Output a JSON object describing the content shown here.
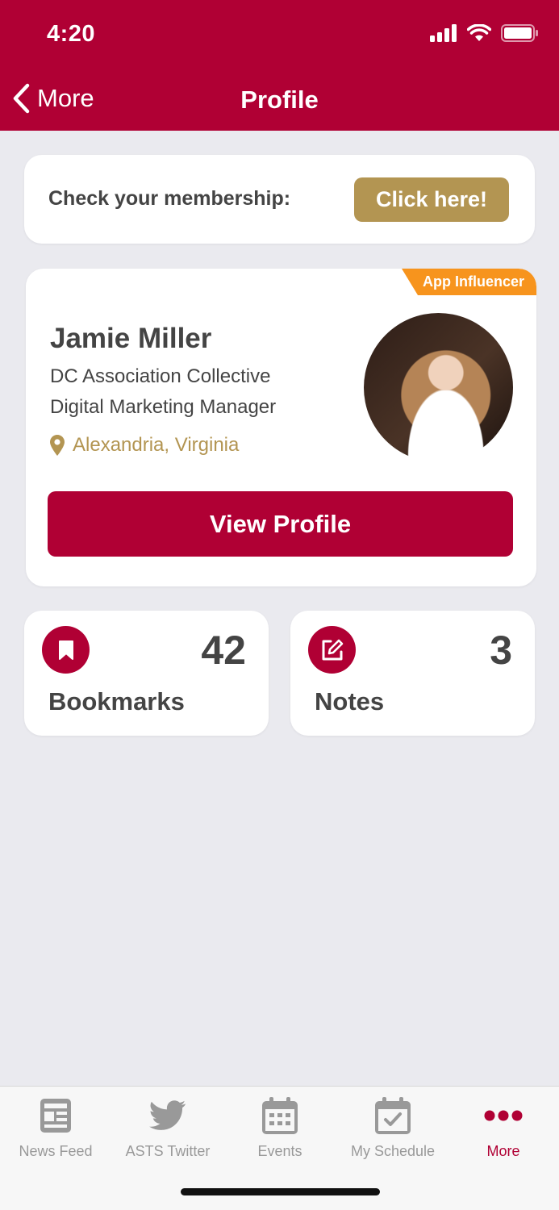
{
  "status": {
    "time": "4:20"
  },
  "nav": {
    "back_label": "More",
    "title": "Profile"
  },
  "membership": {
    "label": "Check your membership:",
    "button": "Click here!"
  },
  "profile": {
    "badge": "App Influencer",
    "name": "Jamie Miller",
    "organization": "DC Association Collective",
    "role": "Digital Marketing Manager",
    "location": "Alexandria, Virginia",
    "view_button": "View Profile"
  },
  "stats": {
    "bookmarks": {
      "count": "42",
      "label": "Bookmarks"
    },
    "notes": {
      "count": "3",
      "label": "Notes"
    }
  },
  "tabs": [
    {
      "label": "News Feed",
      "icon": "newspaper-icon"
    },
    {
      "label": "ASTS Twitter",
      "icon": "twitter-icon"
    },
    {
      "label": "Events",
      "icon": "calendar-icon"
    },
    {
      "label": "My Schedule",
      "icon": "calendar-check-icon"
    },
    {
      "label": "More",
      "icon": "more-dots-icon",
      "active": true
    }
  ],
  "colors": {
    "brand": "#b00034",
    "gold": "#b39552",
    "badge": "#f7941d",
    "background": "#eaeaef"
  }
}
